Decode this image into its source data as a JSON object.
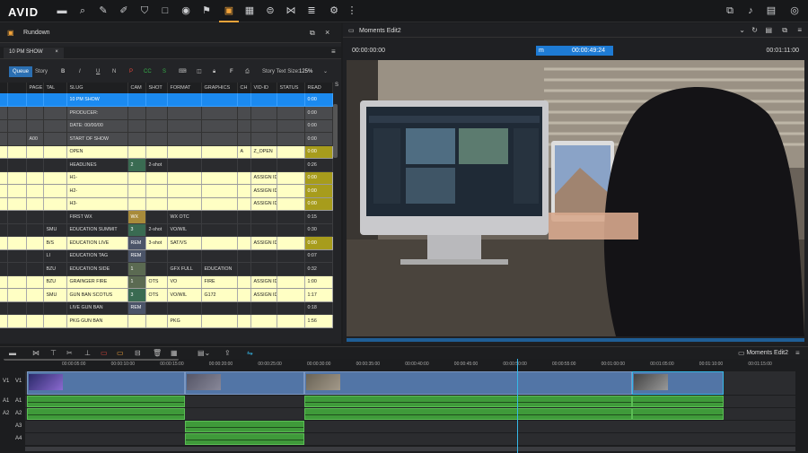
{
  "app": {
    "logo": "AVID"
  },
  "rundown": {
    "title": "Rundown",
    "tab": "10 PM SHOW",
    "queue": "Queue",
    "story": "Story",
    "text_size_label": "Story Text Size:",
    "text_size": "125%",
    "columns": [
      "PAGE",
      "TAL",
      "SLUG",
      "CAM",
      "SHOT",
      "FORMAT",
      "GRAPHICS",
      "CH",
      "VID-ID",
      "STATUS",
      "READ",
      "S"
    ],
    "rows": [
      {
        "style": "sel",
        "page": "",
        "tal": "",
        "slug": "10 PM SHOW",
        "cam": "",
        "shot": "",
        "format": "",
        "graphics": "",
        "ch": "",
        "vid": "",
        "status": "",
        "read": "0:00"
      },
      {
        "style": "grey",
        "page": "",
        "tal": "",
        "slug": "PRODUCER:",
        "cam": "",
        "shot": "",
        "format": "",
        "graphics": "",
        "ch": "",
        "vid": "",
        "status": "",
        "read": "0:00"
      },
      {
        "style": "grey",
        "page": "",
        "tal": "",
        "slug": "DATE: 00/00/00",
        "cam": "",
        "shot": "",
        "format": "",
        "graphics": "",
        "ch": "",
        "vid": "",
        "status": "",
        "read": "0:00"
      },
      {
        "style": "grey",
        "page": "A00",
        "tal": "",
        "slug": "START OF SHOW",
        "cam": "",
        "shot": "",
        "format": "",
        "graphics": "",
        "ch": "",
        "vid": "",
        "status": "",
        "read": "0:00"
      },
      {
        "style": "yel",
        "page": "",
        "tal": "",
        "slug": "OPEN",
        "cam": "",
        "shot": "",
        "format": "",
        "graphics": "",
        "ch": "A",
        "vid": "Z_OPEN",
        "status": "",
        "read": "0:00",
        "readc": "gold"
      },
      {
        "style": "dark",
        "page": "",
        "tal": "",
        "slug": "HEADLINES",
        "cam": "2",
        "camc": "green",
        "shot": "2-shot",
        "format": "",
        "graphics": "",
        "ch": "",
        "vid": "",
        "status": "",
        "read": "0:26"
      },
      {
        "style": "yel",
        "page": "",
        "tal": "",
        "slug": "H1-",
        "cam": "",
        "shot": "",
        "format": "",
        "graphics": "",
        "ch": "",
        "vid": "ASSIGN ID",
        "status": "",
        "read": "0:00",
        "readc": "gold"
      },
      {
        "style": "yel",
        "page": "",
        "tal": "",
        "slug": "H2-",
        "cam": "",
        "shot": "",
        "format": "",
        "graphics": "",
        "ch": "",
        "vid": "ASSIGN ID",
        "status": "",
        "read": "0:00",
        "readc": "gold"
      },
      {
        "style": "yel",
        "page": "",
        "tal": "",
        "slug": "H3-",
        "cam": "",
        "shot": "",
        "format": "",
        "graphics": "",
        "ch": "",
        "vid": "ASSIGN ID",
        "status": "",
        "read": "0:00",
        "readc": "gold"
      },
      {
        "style": "dark",
        "page": "",
        "tal": "",
        "slug": "FIRST WX",
        "cam": "WX",
        "camc": "wx",
        "shot": "",
        "format": "WX OTC",
        "graphics": "",
        "ch": "",
        "vid": "",
        "status": "",
        "read": "0:15"
      },
      {
        "style": "dark",
        "page": "",
        "tal": "SMU",
        "slug": "EDUCATION SUMMIT",
        "cam": "3",
        "camc": "green",
        "shot": "2-shot",
        "format": "VO/WIL",
        "graphics": "",
        "ch": "",
        "vid": "",
        "status": "",
        "read": "0:30"
      },
      {
        "style": "yel",
        "page": "",
        "tal": "B/S",
        "slug": "EDUCATION LIVE",
        "cam": "REM",
        "camc": "rem",
        "shot": "3-shot",
        "format": "SAT/VS",
        "graphics": "",
        "ch": "",
        "vid": "ASSIGN ID",
        "status": "",
        "read": "0:00",
        "readc": "gold"
      },
      {
        "style": "dark",
        "page": "",
        "tal": "LI",
        "slug": "EDUCATION TAG",
        "cam": "REM",
        "camc": "rem",
        "shot": "",
        "format": "",
        "graphics": "",
        "ch": "",
        "vid": "",
        "status": "",
        "read": "0:07"
      },
      {
        "style": "dark",
        "page": "",
        "tal": "BZU",
        "slug": "EDUCATION SIDE",
        "cam": "1",
        "camc": "one",
        "shot": "",
        "format": "GFX FULL",
        "graphics": "EDUCATION",
        "ch": "",
        "vid": "",
        "status": "",
        "read": "0:32"
      },
      {
        "style": "yel",
        "page": "",
        "tal": "BZU",
        "slug": "GRAINGER FIRE",
        "cam": "1",
        "camc": "one",
        "shot": "OTS",
        "format": "VO",
        "graphics": "FIRE",
        "ch": "",
        "vid": "ASSIGN ID",
        "status": "",
        "read": "1:00"
      },
      {
        "style": "yel",
        "page": "",
        "tal": "SMU",
        "slug": "GUN BAN SCOTUS",
        "cam": "3",
        "camc": "green",
        "shot": "OTS",
        "format": "VO/WIL",
        "graphics": "G172",
        "ch": "",
        "vid": "ASSIGN ID",
        "status": "",
        "read": "1:17"
      },
      {
        "style": "dark",
        "page": "",
        "tal": "",
        "slug": "LIVE GUN BAN",
        "cam": "REM",
        "camc": "rem",
        "shot": "",
        "format": "",
        "graphics": "",
        "ch": "",
        "vid": "",
        "status": "",
        "read": "0:18"
      },
      {
        "style": "yel",
        "page": "",
        "tal": "",
        "slug": "PKG GUN BAN",
        "cam": "",
        "shot": "",
        "format": "PKG",
        "graphics": "",
        "ch": "",
        "vid": "",
        "status": "",
        "read": "1:56"
      }
    ]
  },
  "monitor": {
    "title": "Moments Edit2",
    "tc_in": "00:00:00:00",
    "tc_mark": "m",
    "tc_current": "00:00:49:24",
    "tc_out": "00:01:11:00"
  },
  "timeline": {
    "sequence": "Moments Edit2",
    "ticks": [
      "00:00:05:00",
      "00:00:10:00",
      "00:00:15:00",
      "00:00:20:00",
      "00:00:25:00",
      "00:00:30:00",
      "00:00:35:00",
      "00:00:40:00",
      "00:00:45:00",
      "00:00:50:00",
      "00:00:55:00",
      "00:01:00:00",
      "00:01:05:00",
      "00:01:10:00",
      "00:01:15:00"
    ],
    "tracks": [
      "V1",
      "A1",
      "A2",
      "A3",
      "A4"
    ],
    "src_tracks": [
      "V1",
      "A1",
      "A2"
    ]
  }
}
